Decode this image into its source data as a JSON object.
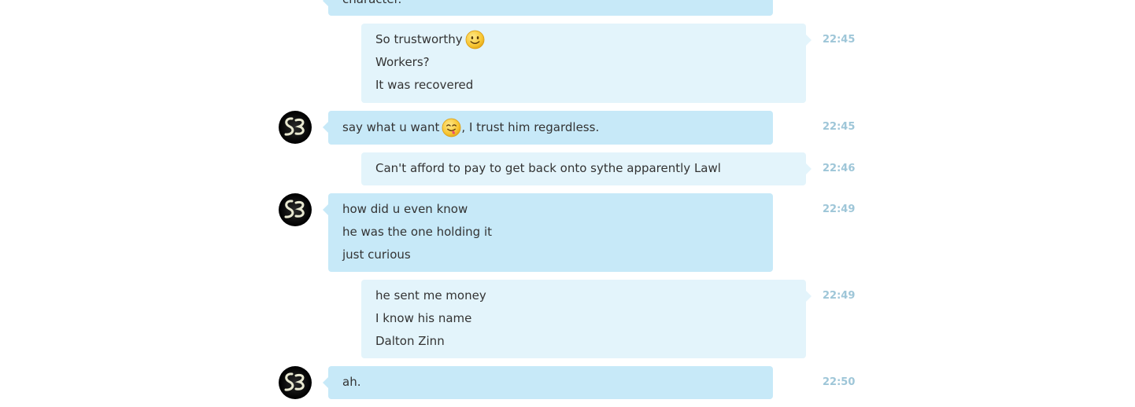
{
  "conversation": {
    "messages": [
      {
        "direction": "incoming",
        "lines": [
          "character."
        ],
        "time": ""
      },
      {
        "direction": "outgoing",
        "lines": [
          "So trustworthy",
          "Workers?",
          "It was recovered"
        ],
        "emoji_after_line0": "smile-emoji-icon",
        "time": "22:45"
      },
      {
        "direction": "incoming",
        "text_before_emoji": "say what u want",
        "text_after_emoji": ", I trust him regardless.",
        "emoji": "tongue-out-emoji-icon",
        "time": "22:45"
      },
      {
        "direction": "outgoing",
        "lines": [
          "Can't afford to pay to get back onto sythe apparently Lawl"
        ],
        "time": "22:46"
      },
      {
        "direction": "incoming",
        "lines": [
          "how did u even know",
          "he was the one holding it",
          "just curious"
        ],
        "time": "22:49"
      },
      {
        "direction": "outgoing",
        "lines": [
          "he sent me money",
          "I know his name",
          "Dalton Zinn"
        ],
        "time": "22:49"
      },
      {
        "direction": "incoming",
        "lines": [
          "ah."
        ],
        "time": "22:50"
      }
    ],
    "avatar_initials": "S3"
  }
}
